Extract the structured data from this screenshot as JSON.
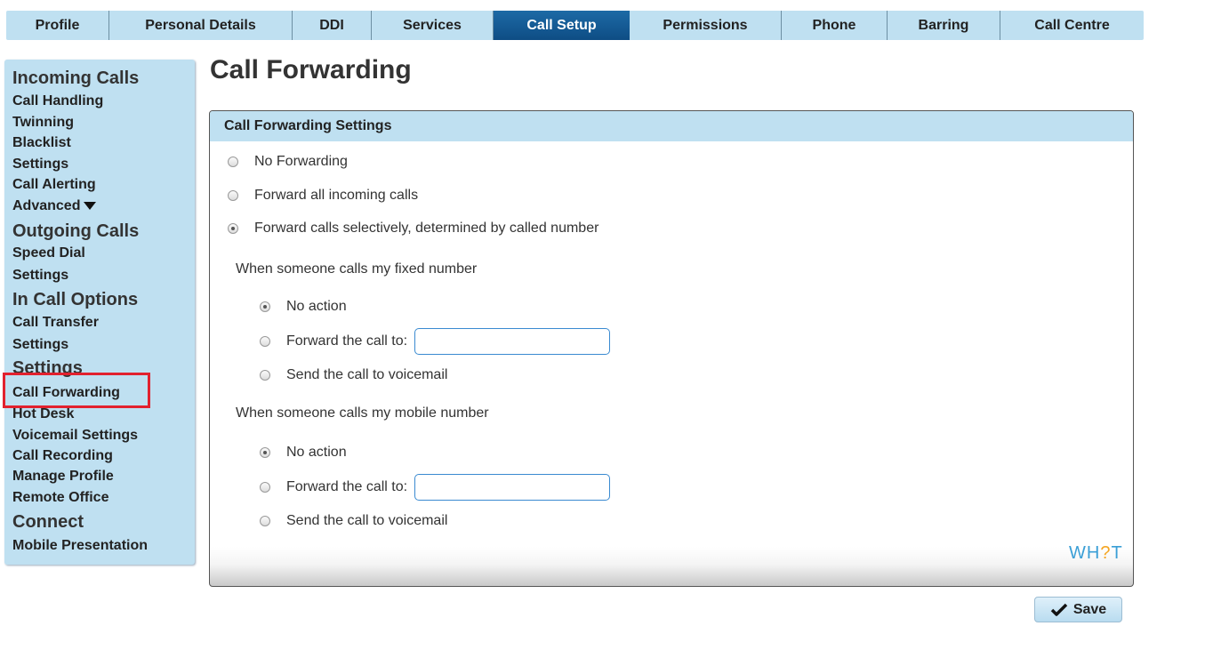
{
  "tabs": [
    {
      "label": "Profile"
    },
    {
      "label": "Personal Details"
    },
    {
      "label": "DDI"
    },
    {
      "label": "Services"
    },
    {
      "label": "Call Setup"
    },
    {
      "label": "Permissions"
    },
    {
      "label": "Phone"
    },
    {
      "label": "Barring"
    },
    {
      "label": "Call Centre"
    }
  ],
  "active_tab": "Call Setup",
  "sidebar": {
    "incoming_heading": "Incoming Calls",
    "call_handling": "Call Handling",
    "twinning": "Twinning",
    "blacklist": "Blacklist",
    "settings_1": "Settings",
    "call_alerting": "Call Alerting",
    "advanced": "Advanced",
    "outgoing_heading": "Outgoing Calls",
    "speed_dial": "Speed Dial",
    "settings_2": "Settings",
    "in_call_heading": "In Call Options",
    "call_transfer": "Call Transfer",
    "settings_3": "Settings",
    "settings_heading": "Settings",
    "call_forwarding": "Call Forwarding",
    "hot_desk": "Hot Desk",
    "voicemail_settings": "Voicemail Settings",
    "call_recording": "Call Recording",
    "manage_profile": "Manage Profile",
    "remote_office": "Remote Office",
    "connect_heading": "Connect",
    "mobile_presentation": "Mobile Presentation"
  },
  "page": {
    "title": "Call Forwarding"
  },
  "panel": {
    "header": "Call Forwarding Settings",
    "opt_no_forwarding": "No Forwarding",
    "opt_forward_all": "Forward all incoming calls",
    "opt_selective": "Forward calls selectively, determined by called number",
    "fixed_heading": "When someone calls my fixed number",
    "fixed_no_action": "No action",
    "fixed_forward_to": "Forward the call to:",
    "fixed_forward_value": "",
    "fixed_voicemail": "Send the call to voicemail",
    "mobile_heading": "When someone calls my mobile number",
    "mobile_no_action": "No action",
    "mobile_forward_to": "Forward the call to:",
    "mobile_forward_value": "",
    "mobile_voicemail": "Send the call to voicemail",
    "logo_left": "WH",
    "logo_mark": "?",
    "logo_right": "T"
  },
  "selection": {
    "main_mode": "Forward calls selectively, determined by called number",
    "fixed_mode": "No action",
    "mobile_mode": "No action"
  },
  "save_label": "Save",
  "colors": {
    "accent_light": "#bfe0f1",
    "accent_active": "#0e4d84",
    "highlight": "#e2212e",
    "logo_blue": "#3b9fd6",
    "logo_orange": "#f5a623"
  }
}
